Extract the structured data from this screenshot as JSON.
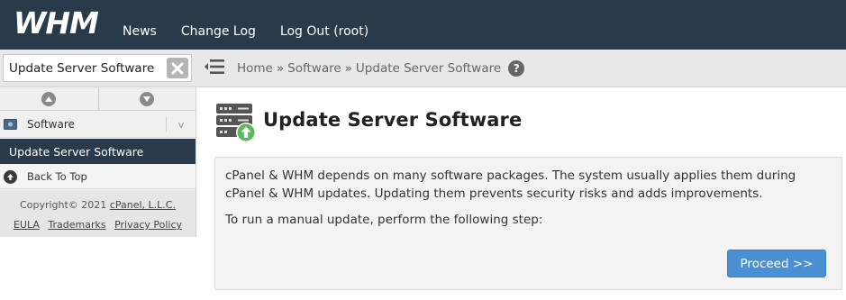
{
  "header": {
    "logo_text": "WHM",
    "nav": [
      {
        "label": "News"
      },
      {
        "label": "Change Log"
      },
      {
        "label": "Log Out (root)"
      }
    ]
  },
  "subbar": {
    "search": {
      "value": "Update Server Software"
    },
    "breadcrumb": {
      "items": [
        "Home",
        "Software",
        "Update Server Software"
      ],
      "separator": "»"
    },
    "help_label": "?"
  },
  "sidebar": {
    "category": {
      "label": "Software",
      "icon": "software-icon",
      "chevron": "v"
    },
    "active_item": "Update Server Software",
    "back_to_top": "Back To Top",
    "footer": {
      "copyright_prefix": "Copyright© 2021",
      "company": "cPanel, L.L.C.",
      "links": [
        "EULA",
        "Trademarks",
        "Privacy Policy"
      ]
    }
  },
  "main": {
    "title": "Update Server Software",
    "icon": "server-update-icon",
    "paragraph1": "cPanel & WHM depends on many software packages. The system usually applies them during cPanel & WHM updates. Updating them prevents security risks and adds improvements.",
    "paragraph2": "To run a manual update, perform the following step:",
    "proceed_label": "Proceed >>"
  },
  "colors": {
    "topbar": "#293a4a",
    "active_item": "#293a4a",
    "primary_button": "#4a90d2"
  }
}
